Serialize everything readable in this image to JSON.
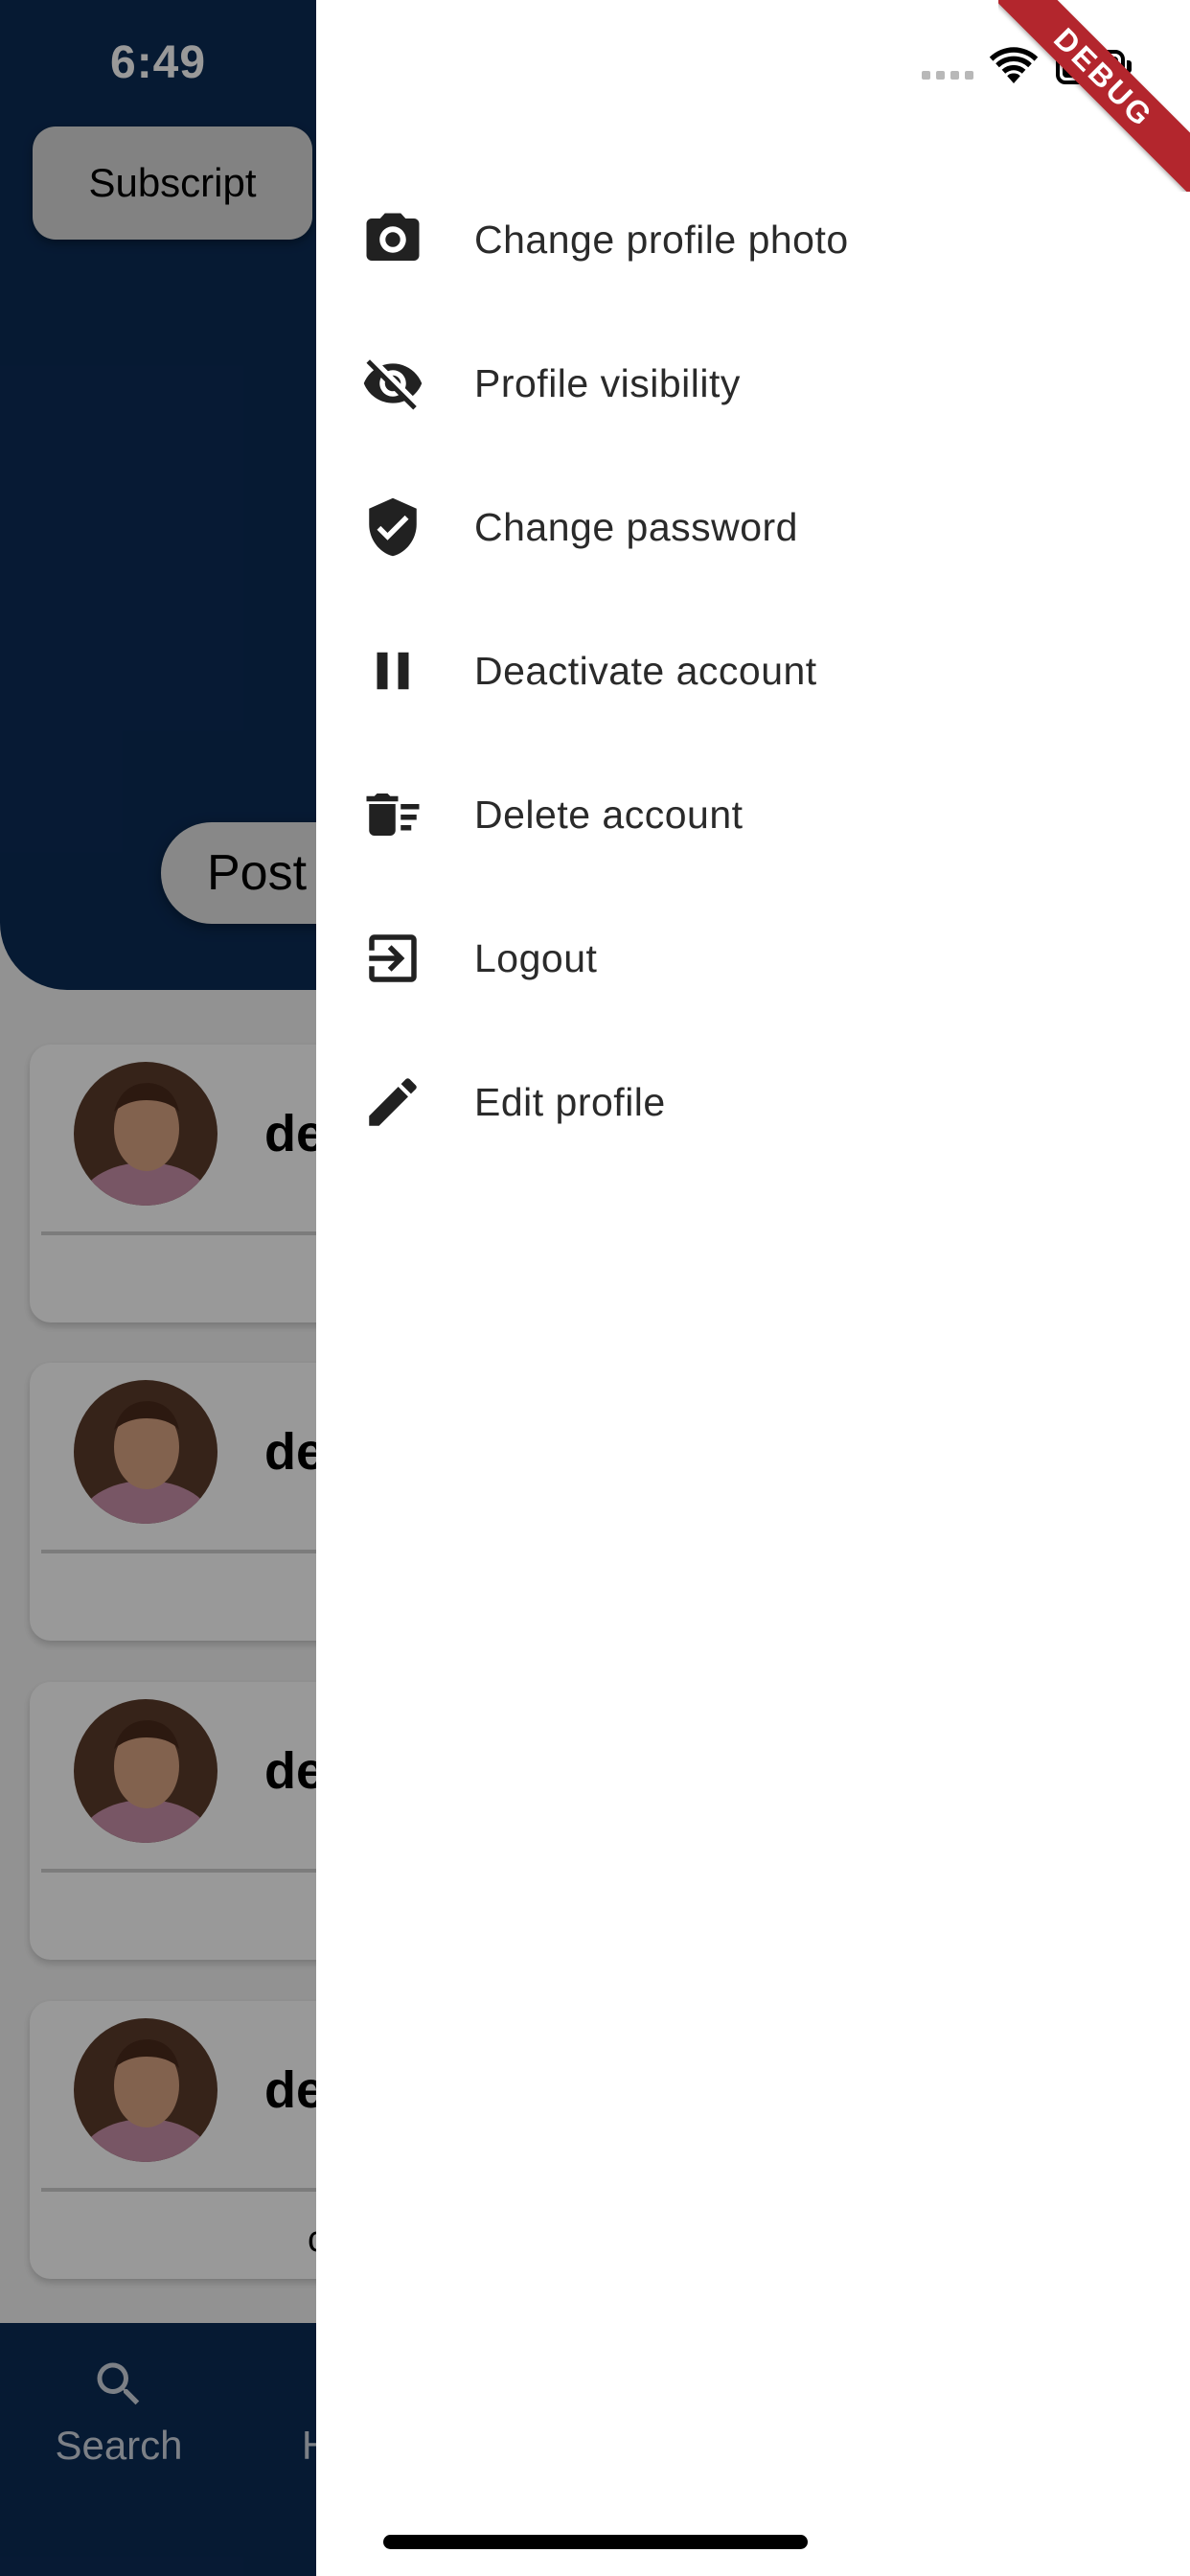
{
  "status_bar": {
    "time": "6:49"
  },
  "background": {
    "subscript_button": "Subscript",
    "posts_tab": "Post",
    "cards": [
      {
        "name": "de",
        "footer": ""
      },
      {
        "name": "de",
        "footer": ""
      },
      {
        "name": "de",
        "footer": ""
      },
      {
        "name": "de",
        "footer": "c"
      }
    ],
    "bottom_nav": [
      {
        "label": "Search",
        "icon": "search-icon"
      },
      {
        "label": "H",
        "icon": ""
      }
    ]
  },
  "drawer": {
    "menu": [
      {
        "label": "Change profile photo",
        "icon": "camera-icon"
      },
      {
        "label": "Profile visibility",
        "icon": "visibility-off-icon"
      },
      {
        "label": "Change password",
        "icon": "shield-check-icon"
      },
      {
        "label": "Deactivate account",
        "icon": "pause-icon"
      },
      {
        "label": "Delete account",
        "icon": "delete-sweep-icon"
      },
      {
        "label": "Logout",
        "icon": "logout-icon"
      },
      {
        "label": "Edit profile",
        "icon": "edit-icon"
      }
    ]
  },
  "debug_banner": "DEBUG",
  "colors": {
    "header_background": "#0b2c56",
    "drawer_background": "#ffffff",
    "icon_color": "#212121",
    "debug_banner": "#b3262d"
  }
}
